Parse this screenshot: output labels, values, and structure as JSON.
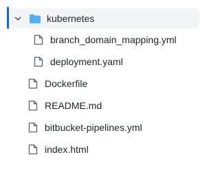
{
  "tree": {
    "folder": {
      "name": "kubernetes",
      "expanded": true,
      "icon": "folder-icon",
      "color": "#54aeff"
    },
    "children": [
      {
        "name": "branch_domain_mapping.yml",
        "icon": "file-icon"
      },
      {
        "name": "deployment.yaml",
        "icon": "file-icon"
      }
    ],
    "files": [
      {
        "name": "Dockerfile",
        "icon": "file-icon"
      },
      {
        "name": "README.md",
        "icon": "file-icon"
      },
      {
        "name": "bitbucket-pipelines.yml",
        "icon": "file-icon"
      },
      {
        "name": "index.html",
        "icon": "file-icon"
      }
    ]
  },
  "colors": {
    "accent": "#0969da",
    "selected_bg": "#f3f4f6",
    "text": "#1f2328",
    "icon": "#57606a"
  }
}
